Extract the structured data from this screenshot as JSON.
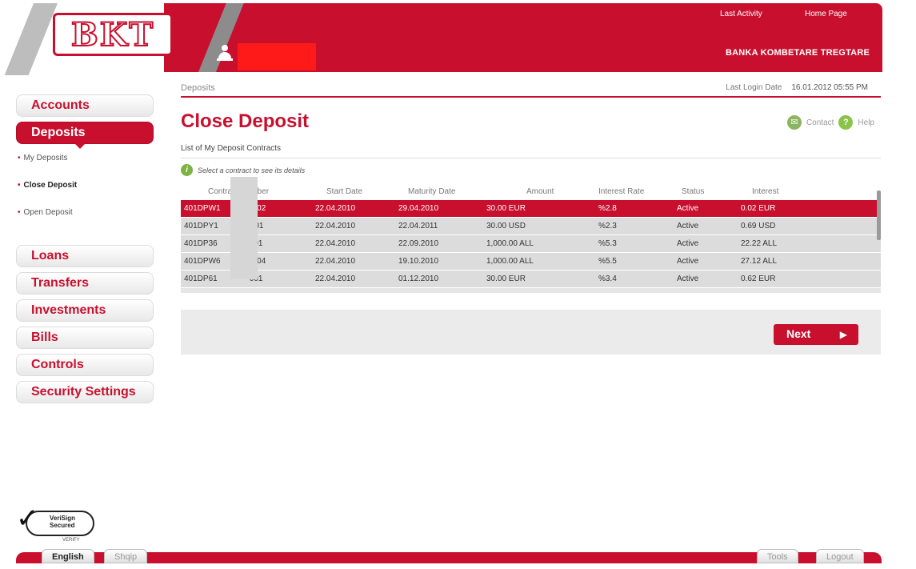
{
  "header": {
    "logo_text": "BKT",
    "links": {
      "last_activity": "Last Activity",
      "home_page": "Home Page"
    },
    "bank_name": "BANKA KOMBETARE TREGTARE"
  },
  "sidebar": {
    "accounts": "Accounts",
    "deposits": "Deposits",
    "sub_items": [
      "My Deposits",
      "Close Deposit",
      "Open Deposit"
    ],
    "loans": "Loans",
    "transfers": "Transfers",
    "investments": "Investments",
    "bills": "Bills",
    "controls": "Controls",
    "security_settings": "Security Settings"
  },
  "main": {
    "breadcrumb": "Deposits",
    "last_login_label": "Last Login Date",
    "last_login_value": "16.01.2012 05:55 PM",
    "title": "Close Deposit",
    "contact": "Contact",
    "help": "Help",
    "list_title": "List of My Deposit Contracts",
    "hint": "Select a contract to see its details",
    "columns": [
      "Contract Number",
      "Start Date",
      "Maturity Date",
      "Amount",
      "Interest Rate",
      "Status",
      "Interest"
    ],
    "rows": [
      [
        "401DPW1",
        "22.04.2010",
        "29.04.2010",
        "30.00 EUR",
        "%2.8",
        "Active",
        "0.02 EUR"
      ],
      [
        "401DPY1",
        "22.04.2010",
        "22.04.2011",
        "30.00 USD",
        "%2.3",
        "Active",
        "0.69 USD"
      ],
      [
        "401DP36",
        "22.04.2010",
        "22.09.2010",
        "1,000.00 ALL",
        "%5.3",
        "Active",
        "22.22 ALL"
      ],
      [
        "401DPW6",
        "22.04.2010",
        "19.10.2010",
        "1,000.00 ALL",
        "%5.5",
        "Active",
        "27.12 ALL"
      ],
      [
        "401DP61",
        "22.04.2010",
        "01.12.2010",
        "30.00 EUR",
        "%3.4",
        "Active",
        "0.62 EUR"
      ]
    ],
    "row_suffixes": [
      "002",
      "001",
      "001",
      "004",
      "001"
    ],
    "next": "Next"
  },
  "footer": {
    "verisign": "VeriSign Secured",
    "verify": "VERIFY",
    "english": "English",
    "shqip": "Shqip",
    "tools": "Tools",
    "logout": "Logout"
  },
  "colors": {
    "brand_red": "#c8102e",
    "row_grey": "#dcdcdc",
    "panel_grey": "#ebebeb"
  }
}
